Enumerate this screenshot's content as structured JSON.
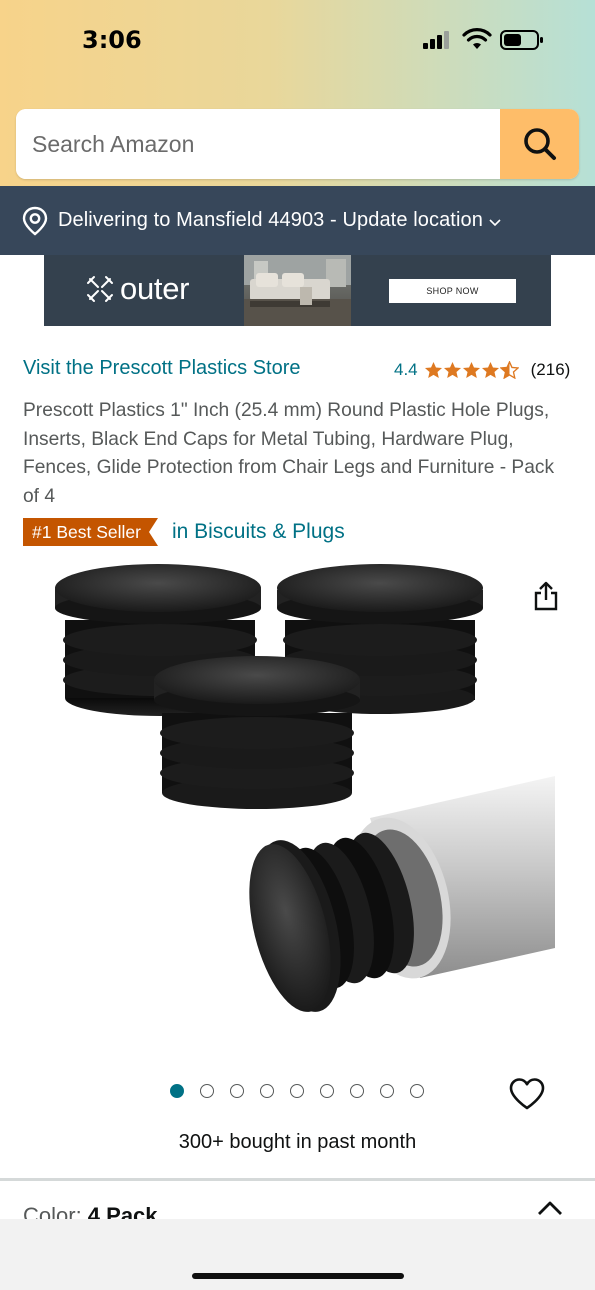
{
  "status_bar": {
    "time": "3:06"
  },
  "search": {
    "placeholder": "Search Amazon"
  },
  "delivery": {
    "text": "Delivering to Mansfield 44903 - Update location"
  },
  "ad": {
    "brand": "outer",
    "cta": "SHOP NOW"
  },
  "product": {
    "store_link": "Visit the Prescott Plastics Store",
    "rating": "4.4",
    "stars": 4.4,
    "rating_count": "(216)",
    "title": "Prescott Plastics 1\" Inch (25.4 mm) Round Plastic Hole Plugs, Inserts, Black End Caps for Metal Tubing, Hardware Plug, Fences, Glide Protection from Chair Legs and Furniture - Pack of 4",
    "badge": "#1 Best Seller",
    "badge_category": "in Biscuits & Plugs",
    "image_count": 9,
    "current_image": 1,
    "bought": "300+ bought in past month",
    "color_label": "Color: ",
    "color_value": "4 Pack"
  },
  "icons": {
    "search": "search-icon",
    "location": "location-pin-icon",
    "share": "share-icon",
    "heart": "heart-icon",
    "caret": "chevron-up-icon"
  },
  "colors": {
    "link": "#007185",
    "star": "#de7921",
    "badge": "#c45500",
    "search_button": "#febd69",
    "delivery_bar": "#37475a"
  }
}
